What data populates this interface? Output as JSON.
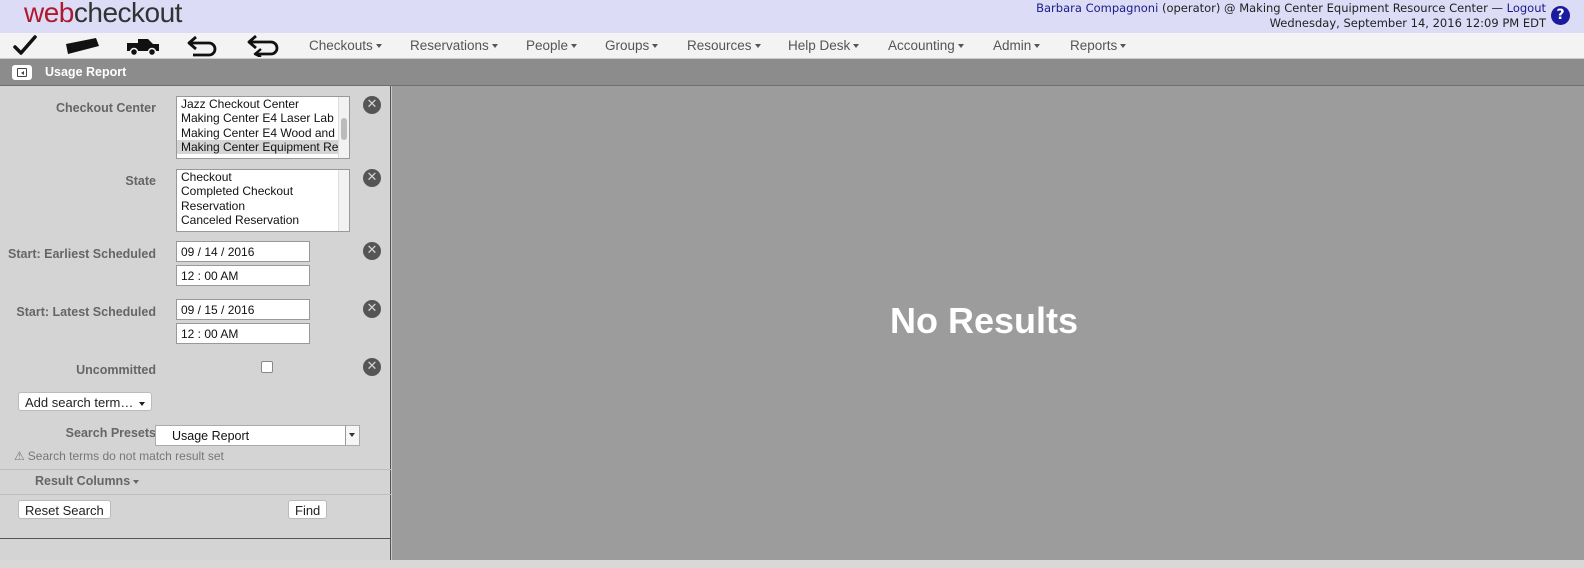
{
  "app": {
    "logo_web": "web",
    "logo_checkout": "checkout"
  },
  "header": {
    "user_name": "Barbara Compagnoni",
    "user_role_location": " (operator) @ Making Center Equipment Resource Center — ",
    "logout_label": "Logout",
    "datetime": "Wednesday, September 14, 2016 12:09 PM EDT",
    "help_glyph": "?"
  },
  "nav": {
    "icons": [
      "checkout-check-icon",
      "reservation-ticket-icon",
      "truck-icon",
      "return-arrow-icon",
      "swap-arrows-icon"
    ],
    "menus": [
      "Checkouts",
      "Reservations",
      "People",
      "Groups",
      "Resources",
      "Help Desk",
      "Accounting",
      "Admin",
      "Reports"
    ]
  },
  "page": {
    "title": "Usage Report"
  },
  "filters": {
    "checkout_center": {
      "label": "Checkout Center",
      "options": [
        "Jazz Checkout Center",
        "Making Center E4 Laser Lab",
        "Making Center E4 Wood and",
        "Making Center Equipment Re"
      ],
      "selected_index": 3
    },
    "state": {
      "label": "State",
      "options": [
        "Checkout",
        "Completed Checkout",
        "Reservation",
        "Canceled Reservation"
      ]
    },
    "start_earliest": {
      "label": "Start: Earliest Scheduled",
      "date": "09 / 14 / 2016",
      "time": "12 : 00 AM"
    },
    "start_latest": {
      "label": "Start: Latest Scheduled",
      "date": "09 / 15 / 2016",
      "time": "12 : 00 AM"
    },
    "uncommitted": {
      "label": "Uncommitted",
      "checked": false
    },
    "clear_glyph": "✕"
  },
  "add_search_term": "Add search term…",
  "search_presets": {
    "label": "Search Presets",
    "value": "Usage Report"
  },
  "warning": {
    "icon": "warning-triangle-icon",
    "text": "Search terms do not match result set",
    "glyph": "⚠"
  },
  "result_columns_label": "Result Columns",
  "buttons": {
    "reset": "Reset Search",
    "find": "Find"
  },
  "results": {
    "message": "No Results"
  },
  "colors": {
    "brand_red": "#b0192b",
    "header_bg": "#dcdcf7",
    "titlebar_bg": "#8c8c8c",
    "results_bg": "#9c9c9c",
    "link_blue": "#1a1a8a"
  }
}
